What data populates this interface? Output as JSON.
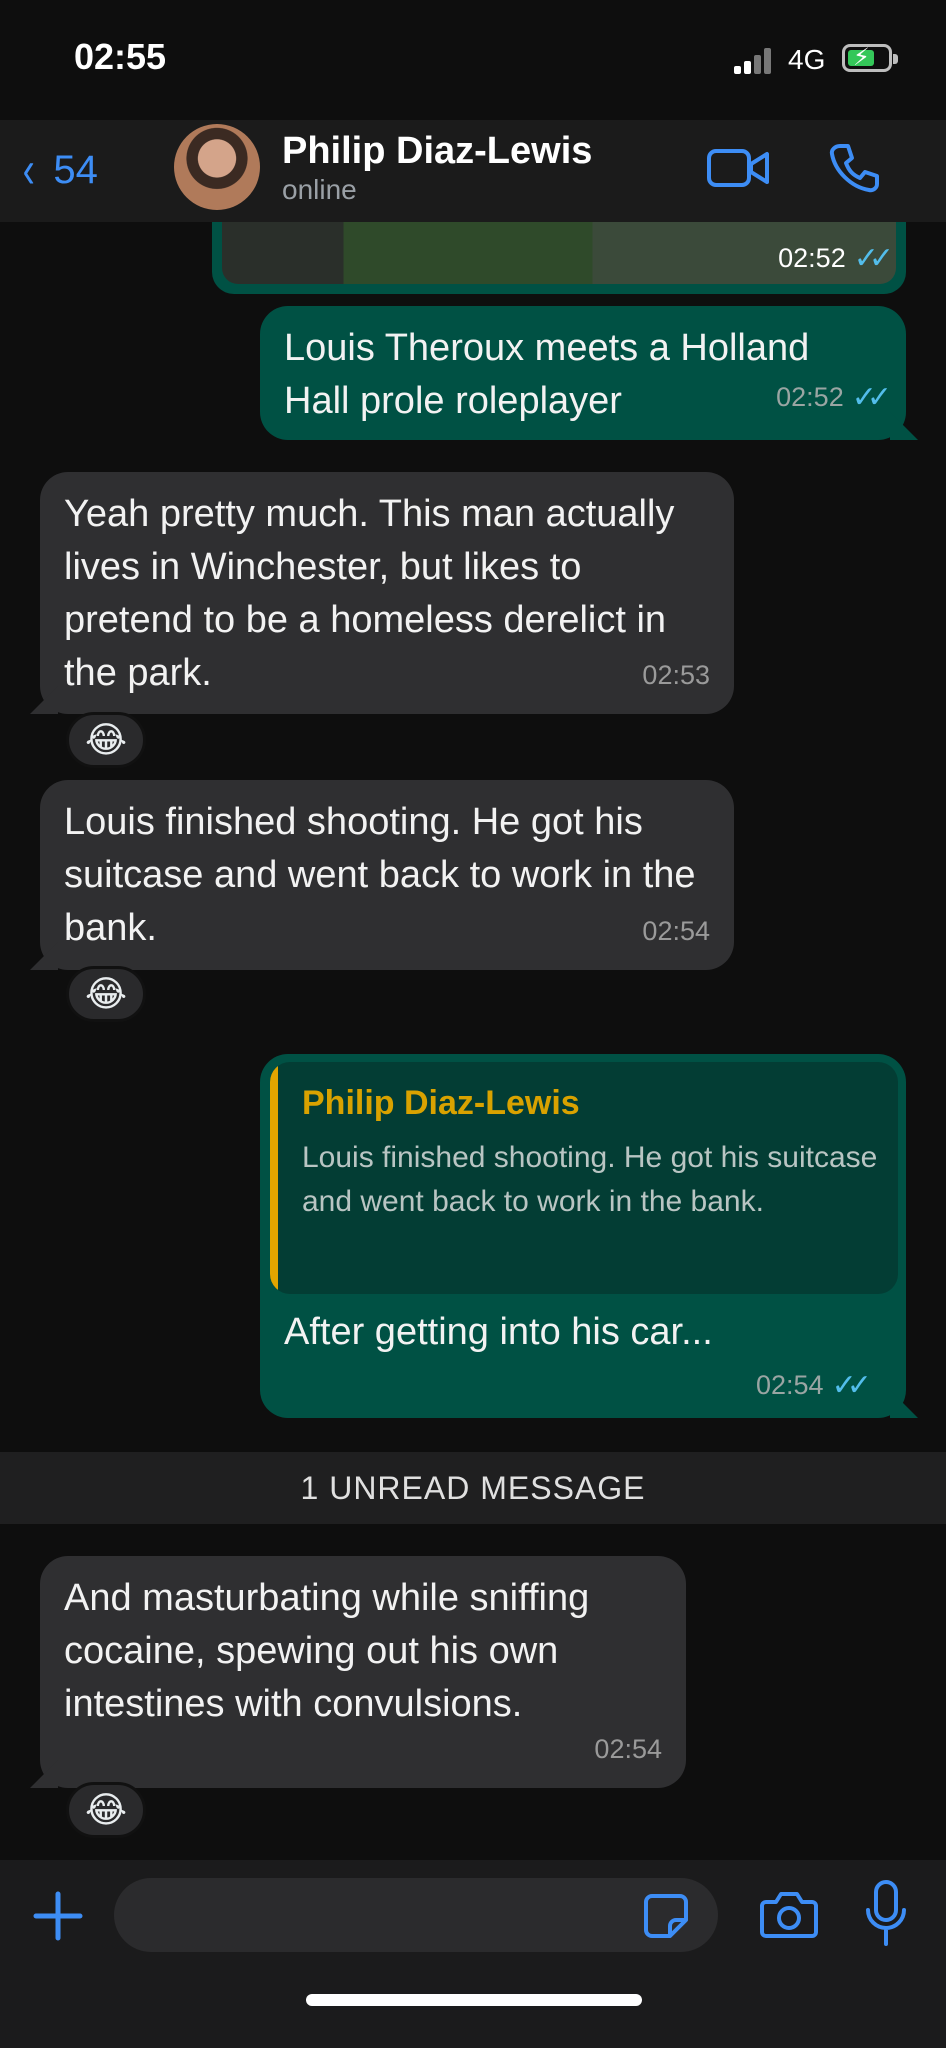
{
  "status_bar": {
    "time": "02:55",
    "network": "4G",
    "battery_icon": "battery-charging-icon"
  },
  "header": {
    "back_count": "54",
    "contact_name": "Philip Diaz-Lewis",
    "contact_status": "online",
    "video_icon": "video-camera-icon",
    "call_icon": "phone-icon"
  },
  "messages": [
    {
      "type": "image",
      "direction": "outgoing",
      "time": "02:52",
      "read": true
    },
    {
      "direction": "outgoing",
      "text": "Louis Theroux meets a Holland Hall prole roleplayer",
      "time": "02:52",
      "read": true
    },
    {
      "direction": "incoming",
      "text": "Yeah pretty much. This man actually lives in Winchester, but likes to pretend to be a homeless derelict in the park.",
      "time": "02:53",
      "reaction": "😂"
    },
    {
      "direction": "incoming",
      "text": "Louis finished shooting. He got his suitcase and went back to work in the bank.",
      "time": "02:54",
      "reaction": "😂"
    },
    {
      "direction": "outgoing",
      "reply_to": {
        "name": "Philip Diaz-Lewis",
        "text": "Louis finished shooting. He got his suitcase and went back to work in the bank."
      },
      "text": "After getting into his car...",
      "time": "02:54",
      "read": true
    },
    {
      "direction": "incoming",
      "text": "And masturbating while sniffing cocaine, spewing out his own intestines with convulsions.",
      "time": "02:54",
      "reaction": "😂"
    }
  ],
  "unread_banner": "1 UNREAD MESSAGE",
  "input_bar": {
    "placeholder": "",
    "plus_icon": "plus-icon",
    "sticker_icon": "sticker-icon",
    "camera_icon": "camera-icon",
    "mic_icon": "microphone-icon"
  },
  "colors": {
    "accent": "#3d8df5",
    "incoming_bubble": "#2f2f31",
    "outgoing_bubble": "#005144",
    "read_ticks": "#53bdeb",
    "quote_name": "#d9a200"
  }
}
